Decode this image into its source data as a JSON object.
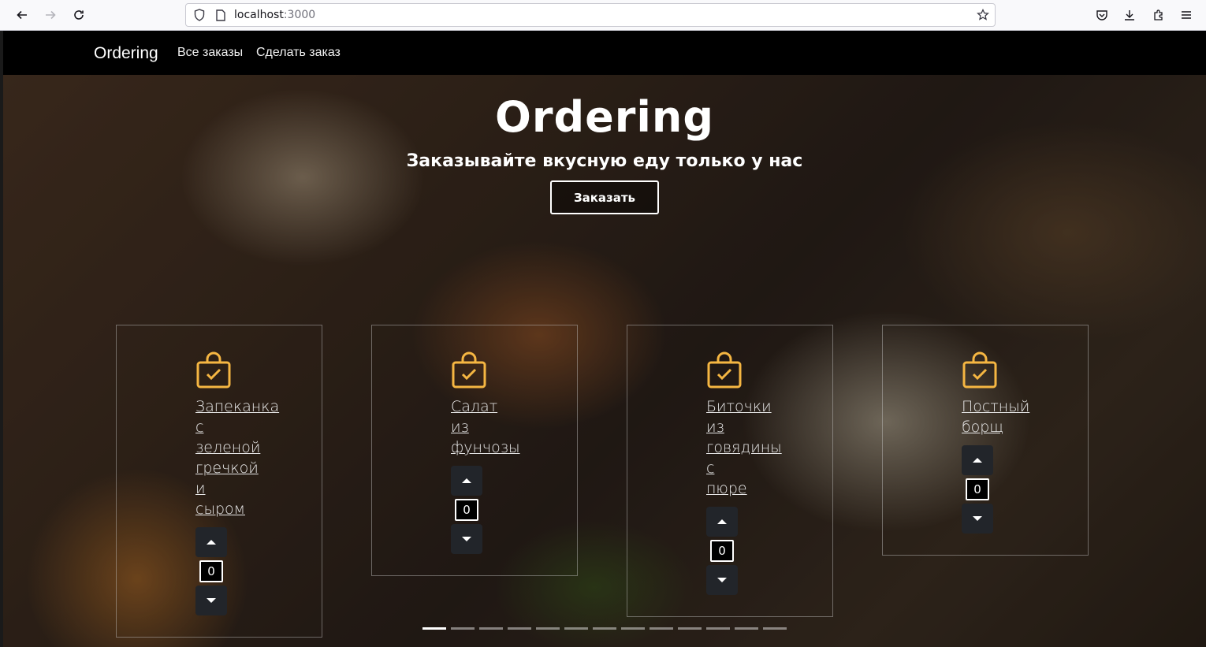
{
  "browser": {
    "url_host": "localhost",
    "url_port": ":3000"
  },
  "navbar": {
    "brand": "Ordering",
    "links": [
      "Все заказы",
      "Сделать заказ"
    ]
  },
  "hero": {
    "title": "Ordering",
    "subtitle": "Заказывайте вкусную еду только у нас",
    "button_label": "Заказать"
  },
  "dishes": [
    {
      "name": "Запеканка с зеленой гречкой и сыром",
      "quantity": "0"
    },
    {
      "name": "Салат из фунчозы",
      "quantity": "0"
    },
    {
      "name": "Биточки из говядины с пюре",
      "quantity": "0"
    },
    {
      "name": "Постный борщ",
      "quantity": "0"
    }
  ],
  "carousel": {
    "slide_count": 13,
    "active_index": 0
  },
  "colors": {
    "accent": "#f5b642",
    "navbar_bg": "#000000",
    "stepper_bg": "#22252a"
  }
}
